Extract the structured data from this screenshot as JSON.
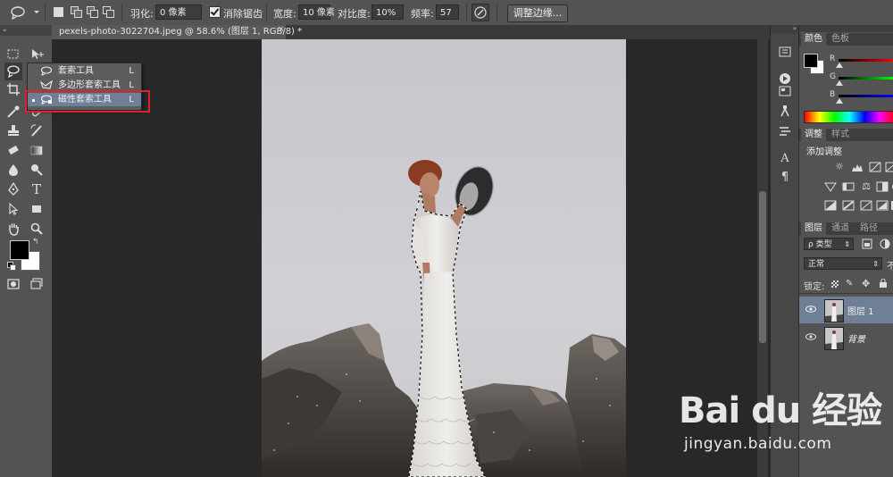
{
  "options_bar": {
    "feather_label": "羽化:",
    "feather_value": "0 像素",
    "antialias_label": "消除锯齿",
    "width_label": "宽度:",
    "width_value": "10 像素",
    "contrast_label": "对比度:",
    "contrast_value": "10%",
    "frequency_label": "频率:",
    "frequency_value": "57",
    "refine_edge_label": "调整边缘..."
  },
  "document": {
    "tab_title": "pexels-photo-3022704.jpeg @ 58.6% (图层 1, RGB/8) *",
    "close": "×"
  },
  "tool_flyout": {
    "items": [
      {
        "label": "套索工具",
        "shortcut": "L"
      },
      {
        "label": "多边形套索工具",
        "shortcut": "L"
      },
      {
        "label": "磁性套索工具",
        "shortcut": "L"
      }
    ]
  },
  "color_panel": {
    "tabs": [
      "颜色",
      "色板"
    ],
    "channels": [
      "R",
      "G",
      "B"
    ]
  },
  "adjust_panel": {
    "tabs": [
      "调整",
      "样式"
    ],
    "heading": "添加调整"
  },
  "layers_panel": {
    "tabs": [
      "图层",
      "通道",
      "路径"
    ],
    "filter_value": "ρ 类型",
    "blend_mode": "正常",
    "opacity_short": "不",
    "lock_label": "锁定:",
    "layers": [
      {
        "name": "图层 1"
      },
      {
        "name": "背景"
      }
    ]
  },
  "watermark": {
    "logo": "Bai du 经验",
    "url": "jingyan.baidu.com"
  },
  "colors": {
    "ui_gray": "#535353",
    "selected_item": "#6f7f96",
    "highlight_red": "#e0212d"
  }
}
